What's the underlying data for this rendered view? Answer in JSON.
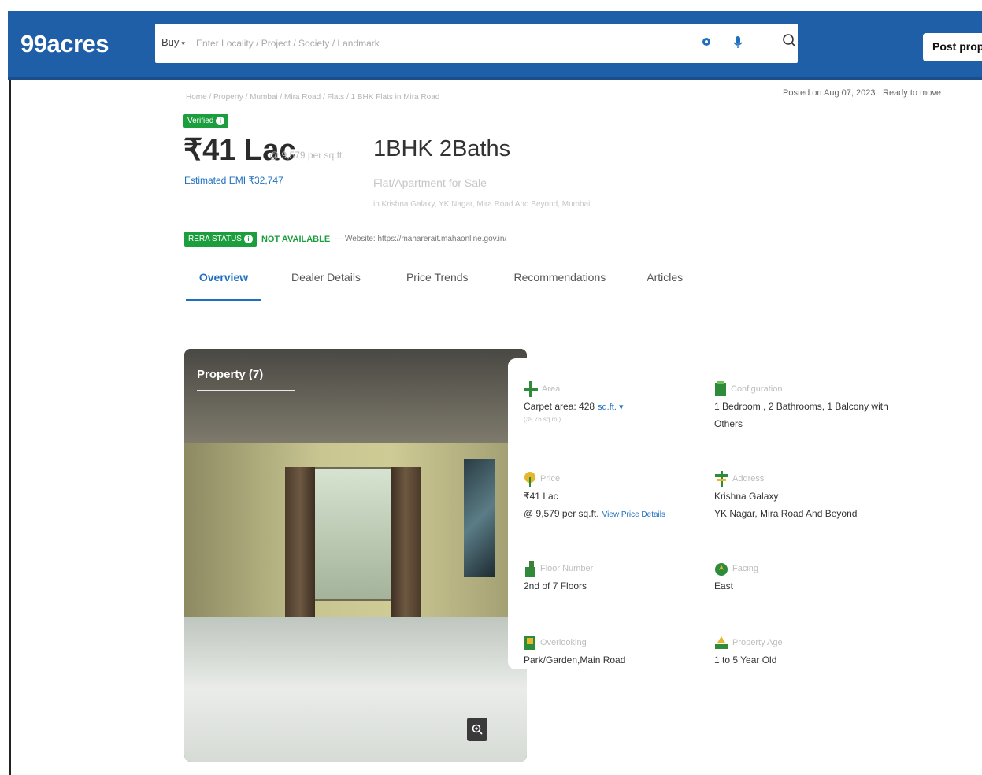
{
  "header": {
    "logo": "99acres",
    "buy_label": "Buy",
    "search_placeholder": "Enter Locality / Project / Society / Landmark",
    "post_button": "Post proper"
  },
  "breadcrumb": "Home / Property / Mumbai / Mira Road / Flats / 1 BHK Flats in Mira Road",
  "posted": "Posted on Aug 07, 2023",
  "possession": "Ready to move",
  "verified": "Verified",
  "price": "₹41 Lac",
  "price_rate": "@ 9,579 per sq.ft.",
  "config_title": "1BHK 2Baths",
  "emi": "Estimated EMI ₹32,747",
  "subtype": "Flat/Apartment for Sale",
  "address_line": "in Krishna Galaxy, YK Nagar, Mira Road And Beyond, Mumbai",
  "rera": {
    "badge": "RERA STATUS",
    "status": "NOT AVAILABLE",
    "website": "— Website: https://maharerait.mahaonline.gov.in/"
  },
  "tabs": [
    "Overview",
    "Dealer Details",
    "Price Trends",
    "Recommendations",
    "Articles"
  ],
  "photo": {
    "label": "Property (7)"
  },
  "details": {
    "area": {
      "label": "Area",
      "value": "Carpet area: 428",
      "unit": "sq.ft.",
      "sub": "(39.76 sq.m.)"
    },
    "configuration": {
      "label": "Configuration",
      "value_1": "1 Bedroom , 2 Bathrooms, 1 Balcony with",
      "value_2": "Others"
    },
    "price": {
      "label": "Price",
      "value_1": "₹41 Lac",
      "value_2": "@ 9,579 per sq.ft.",
      "link": "View Price Details"
    },
    "address": {
      "label": "Address",
      "value_1": "Krishna Galaxy",
      "value_2": "YK Nagar, Mira Road And Beyond"
    },
    "floor": {
      "label": "Floor Number",
      "value": "2nd of 7 Floors"
    },
    "facing": {
      "label": "Facing",
      "value": "East"
    },
    "overlooking": {
      "label": "Overlooking",
      "value": "Park/Garden,Main Road"
    },
    "age": {
      "label": "Property Age",
      "value": "1 to 5 Year Old"
    }
  },
  "colors": {
    "brand": "#1f5fa8",
    "accent": "#1f6fbf",
    "verified": "#1d9e3e"
  }
}
